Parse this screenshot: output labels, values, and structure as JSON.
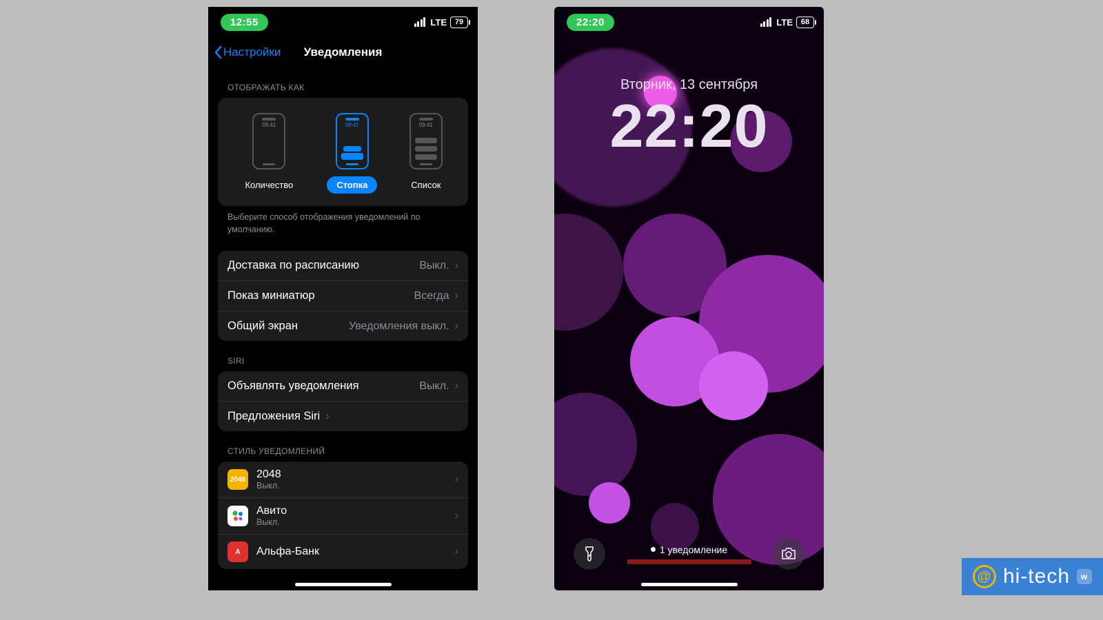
{
  "left": {
    "status": {
      "time": "12:55",
      "net": "LTE",
      "battery": "79"
    },
    "nav": {
      "back": "Настройки",
      "title": "Уведомления"
    },
    "section_display": "ОТОБРАЖАТЬ КАК",
    "preview_time": "09:41",
    "opts": {
      "count": "Количество",
      "stack": "Стопка",
      "list": "Список"
    },
    "caption": "Выберите способ отображения уведомлений по умолчанию.",
    "rows1": [
      {
        "label": "Доставка по расписанию",
        "value": "Выкл."
      },
      {
        "label": "Показ миниатюр",
        "value": "Всегда"
      },
      {
        "label": "Общий экран",
        "value": "Уведомления выкл."
      }
    ],
    "section_siri": "SIRI",
    "rows2": [
      {
        "label": "Объявлять уведомления",
        "value": "Выкл."
      },
      {
        "label": "Предложения Siri",
        "value": ""
      }
    ],
    "section_style": "СТИЛЬ УВЕДОМЛЕНИЙ",
    "apps": [
      {
        "name": "2048",
        "sub": "Выкл.",
        "icon_bg": "#f5b400",
        "icon_txt": "2048",
        "icon_color": "#fff"
      },
      {
        "name": "Авито",
        "sub": "Выкл.",
        "icon_bg": "#ffffff",
        "icon_txt": "",
        "icon_color": "#000"
      },
      {
        "name": "Альфа-Банк",
        "sub": "",
        "icon_bg": "#e03131",
        "icon_txt": "A",
        "icon_color": "#fff"
      }
    ]
  },
  "right": {
    "status": {
      "time": "22:20",
      "net": "LTE",
      "battery": "68"
    },
    "date": "Вторник, 13 сентября",
    "time": "22:20",
    "notif": "1 уведомление"
  },
  "watermark": {
    "text": "hi-tech"
  }
}
